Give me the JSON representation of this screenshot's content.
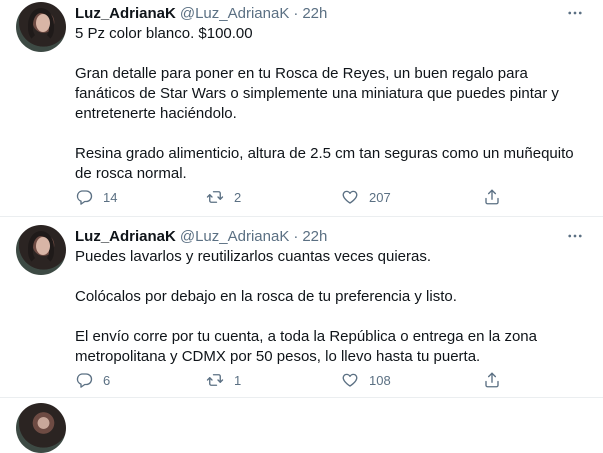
{
  "tweets": [
    {
      "name": "Luz_AdrianaK",
      "handle": "@Luz_AdrianaK",
      "separator": "·",
      "time": "22h",
      "paragraphs": [
        "5 Pz color blanco. $100.00",
        "Gran detalle para poner en tu Rosca de Reyes, un buen regalo para fanáticos de Star Wars o simplemente una miniatura que puedes pintar y entretenerte haciéndolo.",
        "Resina grado alimenticio, altura de 2.5 cm tan seguras como un muñequito de rosca normal."
      ],
      "replies": "14",
      "retweets": "2",
      "likes": "207"
    },
    {
      "name": "Luz_AdrianaK",
      "handle": "@Luz_AdrianaK",
      "separator": "·",
      "time": "22h",
      "paragraphs": [
        "Puedes lavarlos y reutilizarlos cuantas veces quieras.",
        "Colócalos por debajo en la rosca de tu preferencia y listo.",
        "El envío corre por tu cuenta, a toda la República o entrega en la zona metropolitana y CDMX por 50 pesos, lo llevo hasta tu puerta."
      ],
      "replies": "6",
      "retweets": "1",
      "likes": "108"
    }
  ],
  "icons": {
    "more": "more-icon",
    "reply": "reply-icon",
    "retweet": "retweet-icon",
    "like": "like-icon",
    "share": "share-icon"
  },
  "colors": {
    "text": "#0f1419",
    "secondary": "#5b7083",
    "divider": "#ebeef0",
    "background": "#ffffff"
  }
}
